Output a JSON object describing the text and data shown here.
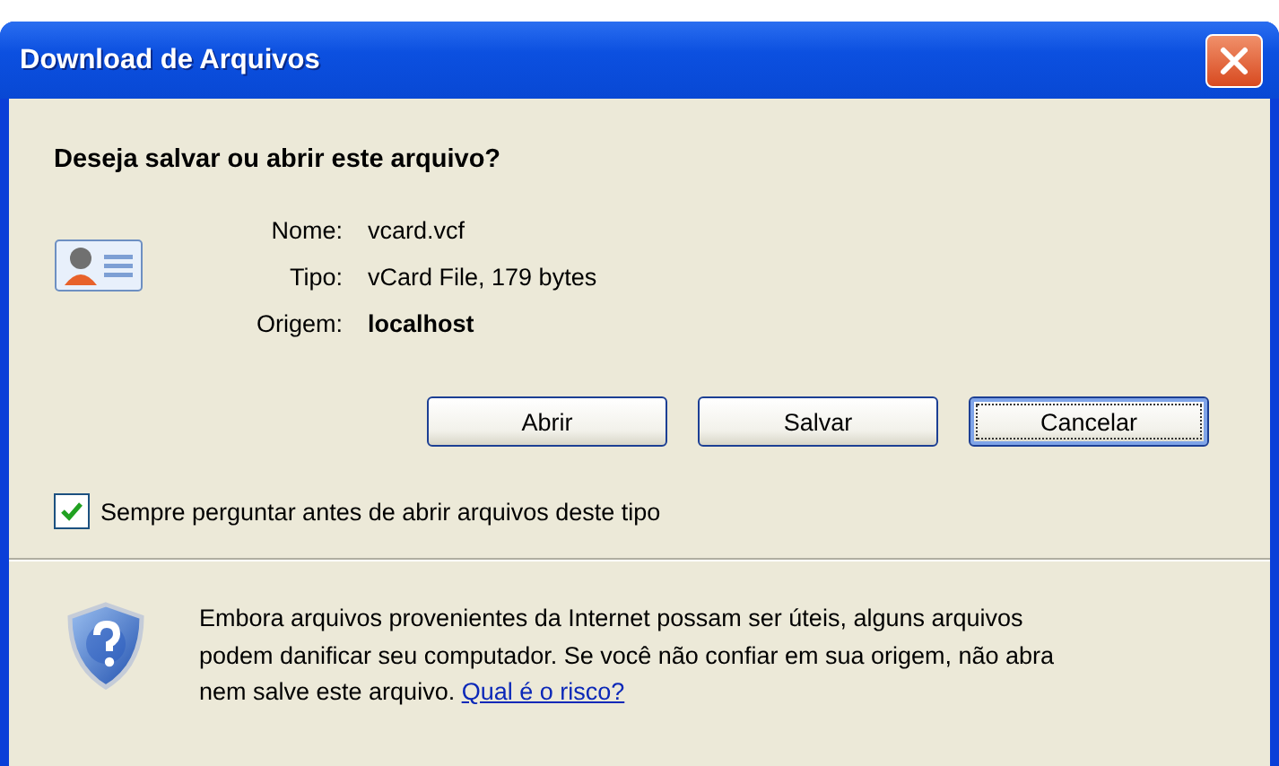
{
  "window": {
    "title": "Download de Arquivos"
  },
  "question": "Deseja salvar ou abrir este arquivo?",
  "file_info": [
    {
      "label": "Nome:",
      "value": "vcard.vcf",
      "bold": false
    },
    {
      "label": "Tipo:",
      "value": "vCard File, 179 bytes",
      "bold": false
    },
    {
      "label": "Origem:",
      "value": "localhost",
      "bold": true
    }
  ],
  "buttons": [
    {
      "label": "Abrir",
      "focused": false
    },
    {
      "label": "Salvar",
      "focused": false
    },
    {
      "label": "Cancelar",
      "focused": true
    }
  ],
  "always_ask": {
    "label": "Sempre perguntar antes de abrir arquivos deste tipo",
    "checked": true
  },
  "warning": {
    "text": "Embora arquivos provenientes da Internet possam ser úteis, alguns arquivos podem danificar seu computador. Se você não confiar em sua origem, não abra nem salve este arquivo.",
    "link": "Qual é o risco?"
  }
}
